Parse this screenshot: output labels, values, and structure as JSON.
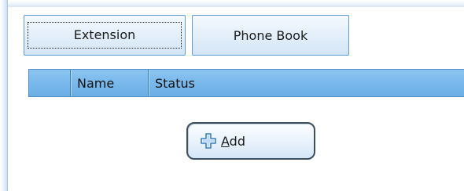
{
  "tabs": [
    {
      "label": "Extension",
      "active": true
    },
    {
      "label": "Phone Book",
      "active": false
    }
  ],
  "table": {
    "columns": [
      "",
      "Name",
      "Status"
    ]
  },
  "add_button": {
    "mnemonic": "A",
    "rest": "dd",
    "icon": "plus-icon"
  },
  "colors": {
    "accent": "#7ab9ec",
    "tab_border": "#5f9bd0",
    "header_border": "#3f7fb8"
  }
}
